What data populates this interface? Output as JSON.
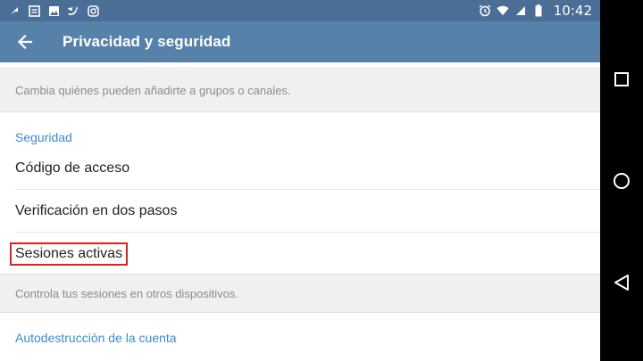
{
  "status_bar": {
    "time": "10:42",
    "left_icons": [
      "pin-icon",
      "clipboard-icon",
      "image-icon",
      "twitter-icon",
      "instagram-icon"
    ],
    "right_icons": [
      "alarm-icon",
      "wifi-icon",
      "signal-icon",
      "battery-icon"
    ]
  },
  "app_bar": {
    "title": "Privacidad y seguridad",
    "back_icon": "arrow-left-icon",
    "color": "#5682a9"
  },
  "main": {
    "groups_hint": "Cambia quiénes pueden añadirte a grupos o canales.",
    "security_header": "Seguridad",
    "items": [
      {
        "label": "Código de acceso"
      },
      {
        "label": "Verificación en dos pasos"
      },
      {
        "label": "Sesiones activas",
        "highlighted": true
      }
    ],
    "sessions_hint": "Controla tus sesiones en otros dispositivos.",
    "self_destruct_header": "Autodestrucción de la cuenta"
  },
  "nav_bar": {
    "buttons": [
      "recents-icon",
      "home-icon",
      "back-icon"
    ]
  },
  "colors": {
    "accent": "#3a8cd1",
    "highlight_border": "#e02020"
  }
}
